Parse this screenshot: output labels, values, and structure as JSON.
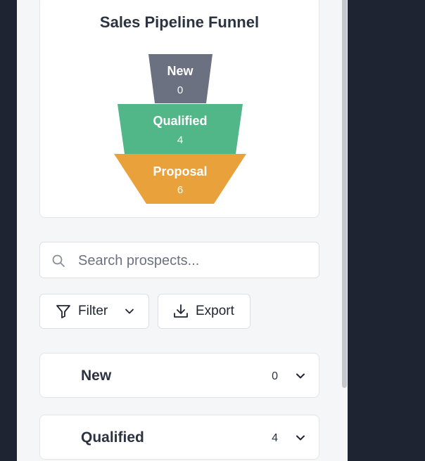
{
  "funnel": {
    "title": "Sales Pipeline Funnel",
    "stages": [
      {
        "label": "New",
        "count": "0",
        "color": "#6b7180"
      },
      {
        "label": "Qualified",
        "count": "4",
        "color": "#52b788"
      },
      {
        "label": "Proposal",
        "count": "6",
        "color": "#e9a23b"
      }
    ]
  },
  "search": {
    "placeholder": "Search prospects..."
  },
  "toolbar": {
    "filter_label": "Filter",
    "export_label": "Export"
  },
  "groups": [
    {
      "label": "New",
      "count": "0"
    },
    {
      "label": "Qualified",
      "count": "4"
    }
  ]
}
